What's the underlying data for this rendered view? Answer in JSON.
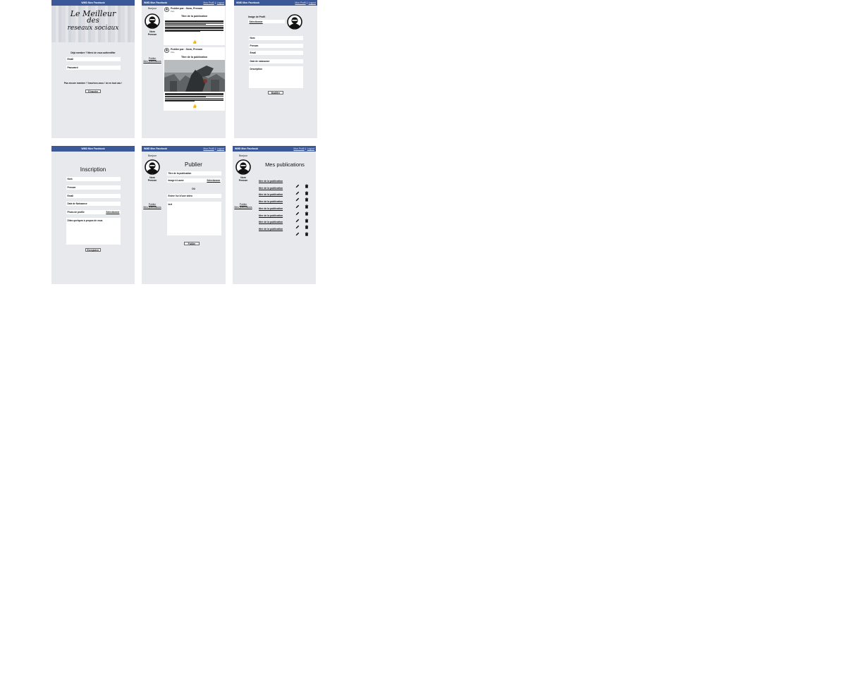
{
  "app_brand": "WMD Mon Facebook",
  "nav": {
    "profile": "Mon Profil",
    "separator": "|",
    "logout": "Logout"
  },
  "sidebar": {
    "greeting": "Bonjour",
    "name": "Nom",
    "surname": "Prenom",
    "link_publish": "Publier",
    "link_my_pubs": "Mes publications"
  },
  "login": {
    "logo_line1": "Le Meilleur",
    "logo_line2": "des",
    "logo_line3": "reseaux sociaux",
    "prompt": "Déjà membre ? Merci de vous authentifier",
    "email_placeholder": "Email",
    "password_placeholder": "Password",
    "signup_prompt": "Pas encore membre ? Inscrivez-vous ! ici en tout cas !",
    "signup_button": "S'inscrire"
  },
  "feed": {
    "posts": [
      {
        "author": "Publier par : Nom, Prenom",
        "date": "Date",
        "title": "Titre de la publication",
        "has_image": false
      },
      {
        "author": "Publier par : Nom, Prenom",
        "date": "Date",
        "title": "Titre de la publication",
        "has_image": true
      }
    ],
    "like_icon": "thumbs-up-icon"
  },
  "profile": {
    "image_label": "Image de Profil",
    "select_button": "Selectionner",
    "fields": [
      "Nom",
      "Prenom",
      "Email",
      "Date de naissance"
    ],
    "description_label": "Description",
    "submit_button": "Modifier"
  },
  "signup": {
    "title": "Inscription",
    "fields": [
      "Nom",
      "Prenom",
      "Email",
      "Date de Naissance"
    ],
    "photo_label": "Photo de profile",
    "select_button": "Selectionner",
    "about_placeholder": "Dites quelques à propos de vous",
    "submit_button": "Enregistrer"
  },
  "publish": {
    "title": "Publier",
    "title_placeholder": "Titre de la publication",
    "image_label": "Image à Laune",
    "select_button": "Selectionner",
    "or_label": "OU",
    "url_placeholder": "Entrer l'url d'une vidéo",
    "text_placeholder": "text",
    "submit_button": "Publier"
  },
  "my_pubs": {
    "title": "Mes publications",
    "items": [
      "titre de la publication",
      "titre de la publication",
      "titre de la publication",
      "titre de la publication",
      "titre de la publication",
      "titre de la publication",
      "titre de la publication",
      "titre de la publication"
    ],
    "edit_icon": "pencil-icon",
    "delete_icon": "trash-icon"
  }
}
